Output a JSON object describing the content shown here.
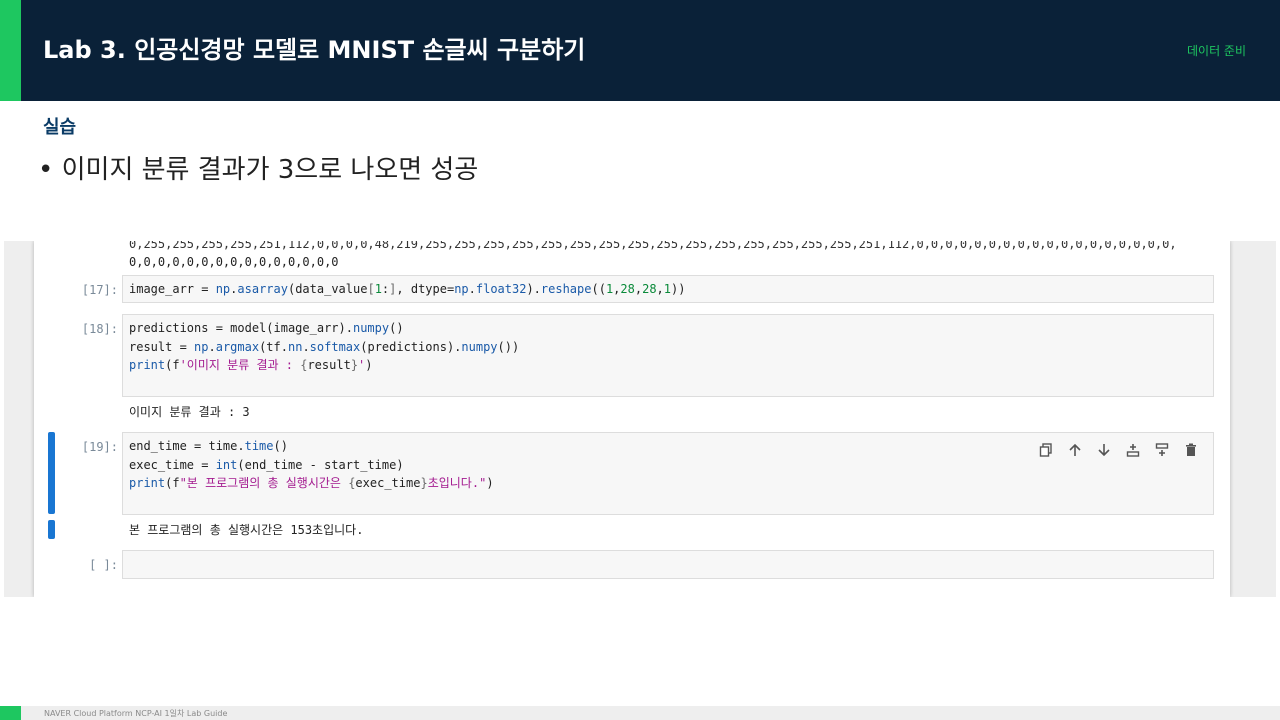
{
  "header": {
    "title": "Lab 3. 인공신경망 모델로 MNIST 손글씨 구분하기",
    "section": "데이터 준비"
  },
  "subheading": "실습",
  "bullet": "• 이미지 분류 결과가 3으로 나오면 성공",
  "notebook": {
    "truncated_output_line1": "0,255,255,255,255,251,112,0,0,0,0,48,219,255,255,255,255,255,255,255,255,255,255,255,255,255,255,255,251,112,0,0,0,0,0,0,0,0,0,0,0,0,0,0,0,0,0,0,",
    "truncated_output_line2": "0,0,0,0,0,0,0,0,0,0,0,0,0,0,0",
    "cells": [
      {
        "prompt": "[17]:",
        "code": [
          "image_arr = np.asarray(data_value[1:], dtype=np.float32).reshape((1,28,28,1))"
        ]
      },
      {
        "prompt": "[18]:",
        "code": [
          "predictions = model(image_arr).numpy()",
          "result = np.argmax(tf.nn.softmax(predictions).numpy())",
          "print(f'이미지 분류 결과 : {result}')"
        ],
        "output": "이미지 분류 결과 : 3"
      },
      {
        "prompt": "[19]:",
        "code": [
          "end_time = time.time()",
          "exec_time = int(end_time - start_time)",
          "print(f\"본 프로그램의 총 실행시간은 {exec_time}초입니다.\")"
        ],
        "output": "본 프로그램의 총 실행시간은 153초입니다."
      },
      {
        "prompt": "[ ]:",
        "code": []
      }
    ],
    "toolbar_icons": [
      "copy-icon",
      "arrow-up-icon",
      "arrow-down-icon",
      "insert-above-icon",
      "insert-below-icon",
      "trash-icon"
    ]
  },
  "footer": "NAVER Cloud Platform  NCP-AI 1일차 Lab Guide",
  "colors": {
    "header_bg": "#0a2138",
    "accent_green": "#1ec760",
    "selected_bar": "#1976d2"
  }
}
